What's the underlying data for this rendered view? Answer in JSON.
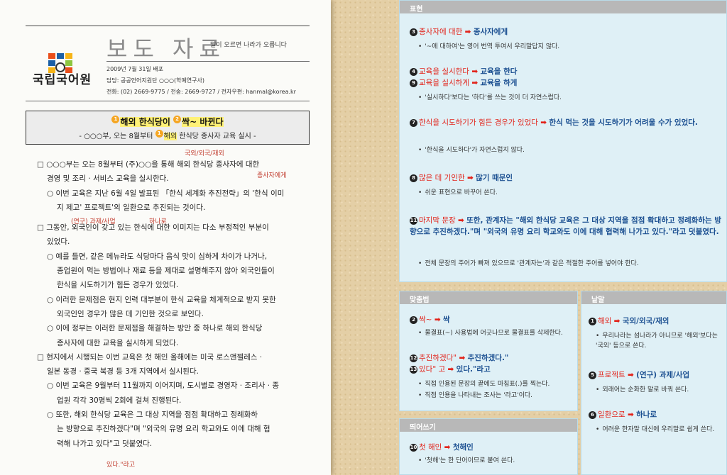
{
  "doc": {
    "org": "국립국어원",
    "title": "보도 자료",
    "slogan": "말이 오르면 나라가 오릅니다",
    "date": "2009년 7월 31일 배포",
    "owner": "담당: 공공언어지원단 ○○○(학예연구사)",
    "contact": "전화: (02) 2669-9775 / 전송: 2669-9727 / 전자우편: hanmal@korea.kr",
    "headline": {
      "n1": "1",
      "a": "해외 한식당이",
      "n2": "2",
      "b": "싹~ 바뀐다"
    },
    "subhead": {
      "pre": "- ○○○부, 오는 8월부터",
      "n": "1",
      "a": "해외",
      "post": "한식당 종사자 교육 실시 -"
    },
    "lines": [
      "□ ○○○부는 오는 8월부터 (주)○○을 통해 해외 한식당 종사자에 대한",
      "경영 및 조리 · 서비스 교육을 실시한다.",
      "○ 이번 교육은 지난 6월 4일 발표된 「한식 세계화 추진전략」의 '한식 이미",
      "지 제고' 프로젝트'의 일환으로 추진되는 것이다.",
      "□ 그동안, 외국인이 갖고 있는 한식에 대한 이미지는 다소 부정적인 부분이",
      "있었다.",
      "○ 예를 들면, 같은 메뉴라도 식당마다 음식 맛이 심하게 차이가 나거나,",
      "종업원이 먹는 방법이나 재료 등을 제대로 설명해주지 않아 외국인들이",
      "한식을 시도하기가 힘든 경우가 있었다.",
      "○ 이러한 문제점은 현지 인력 대부분이 한식 교육을 체계적으로 받지 못한",
      "외국인인 경우가 많은 데 기인한 것으로 보인다.",
      "○ 이에 정부는 이러한 문제점을 해결하는 방안 중 하나로 해외 한식당",
      "종사자에 대한 교육을 실시하게 되었다.",
      "□ 현지에서 시행되는 이번 교육은 첫 해인 올해에는 미국 로스앤젤레스 ·",
      "일본 동경 · 중국 북경 등 3개 지역에서 실시된다.",
      "○ 이번 교육은 9월부터 11월까지 이어지며, 도시별로 경영자 · 조리사 · 종",
      "업원 각각 30명씩 2회에 걸쳐 진행된다.",
      "○ 또한, 해외 한식당 교육은 그 대상 지역을 점점 확대하고 정례화하",
      "는 방향으로 추진하겠다\"며 \"외국의 유명 요리 학교와도 이에 대해 협",
      "력해 나가고 있다\"고 덧붙였다."
    ],
    "annotations": [
      "국외/외국/재외",
      "종사자에게",
      "(연구) 과제/사업",
      "하나로",
      "있다.\"라고"
    ]
  },
  "panels": {
    "pyohyeon": {
      "title": "표현",
      "entries": [
        {
          "num": "3",
          "q": "종사자에 대한",
          "fix": "종사자에게",
          "exp": "'~에 대하여'는 영어 번역 투여서 우리말답지 않다."
        },
        {
          "num": "4",
          "q": "교육을 실시한다",
          "fix": "교육을 한다"
        },
        {
          "num": "9",
          "q": "교육을 실시하게",
          "fix": "교육을 하게",
          "exp": "'실시하다'보다는 '하다'를 쓰는 것이 더 자연스럽다."
        },
        {
          "num": "7",
          "q": "한식을 시도하기가 힘든 경우가 있었다",
          "fix": "한식 먹는 것을 시도하기가 어려울 수가 있었다.",
          "exp": "'한식을 시도하다'가 자연스럽지 않다."
        },
        {
          "num": "8",
          "q": "많은 데 기인한",
          "fix": "많기 때문인",
          "exp": "쉬운 표현으로 바꾸어 쓴다."
        },
        {
          "num": "11",
          "q": "마지막 문장",
          "fix": "또한, 관계자는 \"해외 한식당 교육은 그 대상 지역을 점점 확대하고 정례화하는 방향으로 추진하겠다.\"며 \"외국의 유명 요리 학교와도 이에 대해 협력해 나가고 있다.\"라고 덧붙였다.",
          "exp": "전체 문장의 주어가 빠져 있으므로 '관계자는'과 같은 적절한 주어를 넣어야 한다."
        }
      ]
    },
    "matchum": {
      "title": "맞춤법",
      "entries": [
        {
          "num": "2",
          "q": "싹~",
          "fix": "싹",
          "exp": "물결표(~) 사용법에 어긋나므로 물결표를 삭제한다."
        },
        {
          "num": "12",
          "q": "추진하겠다\"",
          "fix": "추진하겠다.\""
        },
        {
          "num": "13",
          "q": "있다\" 고",
          "fix": "있다.\"라고",
          "exp1": "직접 인용된 문장의 끝에도 마침표(.)를 찍는다.",
          "exp2": "직접 인용을 나타내는 조사는 '라고'이다."
        }
      ]
    },
    "ttuieo": {
      "title": "띄어쓰기",
      "entries": [
        {
          "num": "10",
          "q": "첫 해인",
          "fix": "첫해인",
          "exp": "'첫해'는 한 단어이므로 붙여 쓴다."
        }
      ]
    },
    "natmal": {
      "title": "낱말",
      "entries": [
        {
          "num": "1",
          "q": "해외",
          "fix": "국외/외국/재외",
          "exp": "우리나라는 섬나라가 아니므로 '해외'보다는 '국외' 등으로 쓴다."
        },
        {
          "num": "5",
          "q": "프로젝트",
          "fix": "(연구) 과제/사업",
          "exp": "외래어는 순화한 말로 바꿔 쓴다."
        },
        {
          "num": "6",
          "q": "일환으로",
          "fix": "하나로",
          "exp": "어려운 한자말 대신에 우리말로 쉽게 쓴다."
        }
      ]
    }
  },
  "arrow": "➡"
}
